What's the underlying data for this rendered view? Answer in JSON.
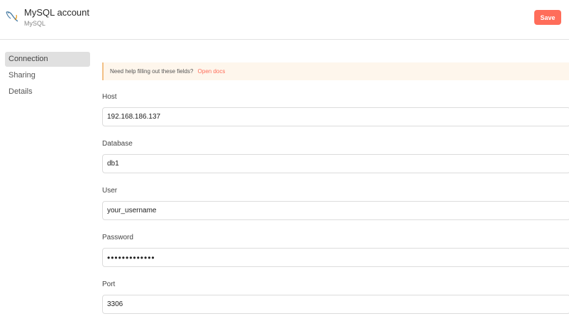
{
  "header": {
    "title": "MySQL account",
    "subtitle": "MySQL",
    "save_label": "Save",
    "save_color": "#ff6d5a"
  },
  "sidebar": {
    "items": [
      {
        "label": "Connection",
        "active": true
      },
      {
        "label": "Sharing",
        "active": false
      },
      {
        "label": "Details",
        "active": false
      }
    ]
  },
  "notice": {
    "text": "Need help filling out these fields?",
    "link": "Open docs"
  },
  "fields": {
    "host": {
      "label": "Host",
      "value": "192.168.186.137"
    },
    "database": {
      "label": "Database",
      "value": "db1"
    },
    "user": {
      "label": "User",
      "value": "your_username"
    },
    "password": {
      "label": "Password",
      "value": "•••••••••••••"
    },
    "port": {
      "label": "Port",
      "value": "3306"
    }
  },
  "icons": {
    "logo": "mysql-dolphin-icon"
  }
}
